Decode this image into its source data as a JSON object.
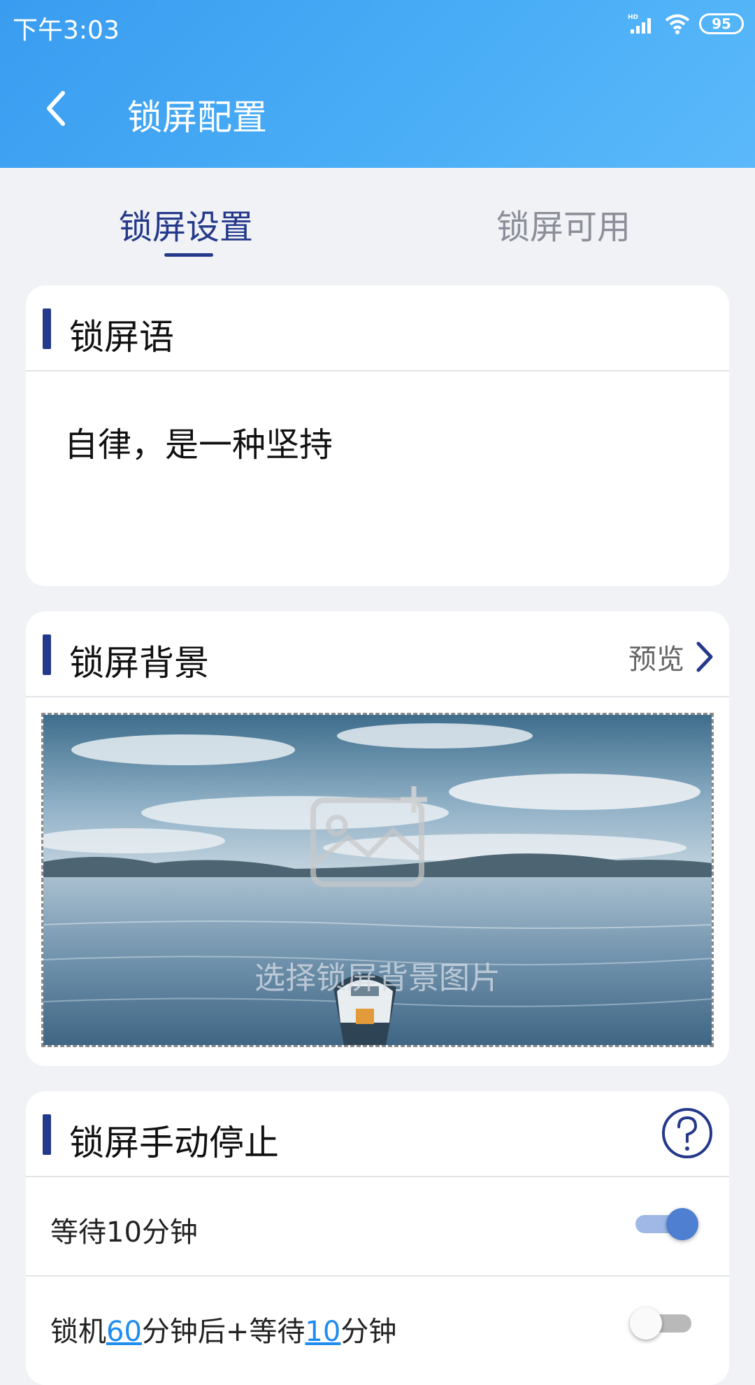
{
  "status_bar": {
    "time": "下午3:03",
    "battery": "95",
    "icons": [
      "hd-signal-icon",
      "wifi-icon",
      "battery-icon"
    ]
  },
  "header": {
    "title": "锁屏配置",
    "back_icon": "chevron-left-icon"
  },
  "tabs": [
    {
      "label": "锁屏设置",
      "active": true
    },
    {
      "label": "锁屏可用",
      "active": false
    }
  ],
  "motto_card": {
    "title": "锁屏语",
    "text": "自律，是一种坚持"
  },
  "background_card": {
    "title": "锁屏背景",
    "preview_label": "预览",
    "hint": "选择锁屏背景图片"
  },
  "manual_stop_card": {
    "title": "锁屏手动停止",
    "options": [
      {
        "label": "等待10分钟",
        "enabled": true
      },
      {
        "parts": [
          "锁机",
          "60",
          "分钟后+等待",
          "10",
          "分钟"
        ],
        "enabled": false
      }
    ]
  },
  "colors": {
    "header_gradient_start": "#3a9cf0",
    "accent": "#24398a",
    "link": "#1e8cf0",
    "toggle_on": "#4f7fd1"
  }
}
